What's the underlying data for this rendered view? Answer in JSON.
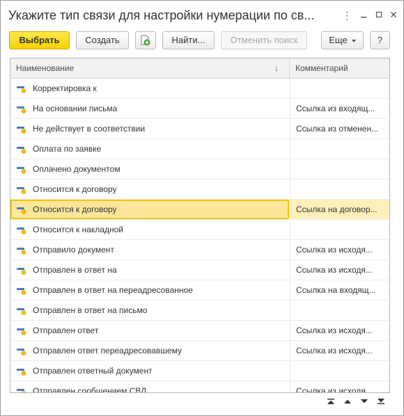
{
  "window": {
    "title": "Укажите тип связи для настройки нумерации по св...",
    "controls": {
      "more": "⋮",
      "minimize": "",
      "maximize": "",
      "close": ""
    }
  },
  "toolbar": {
    "select_label": "Выбрать",
    "create_label": "Создать",
    "find_label": "Найти...",
    "cancel_search_label": "Отменить поиск",
    "more_label": "Еще",
    "help_label": "?"
  },
  "grid": {
    "columns": {
      "name": "Наименование",
      "comment": "Комментарий",
      "sort": "↓"
    },
    "selected_index": 6,
    "rows": [
      {
        "name": "Корректировка к",
        "comment": ""
      },
      {
        "name": "На основании письма",
        "comment": "Ссылка из входящ..."
      },
      {
        "name": "Не действует в соответствии",
        "comment": "Ссылка из отменен..."
      },
      {
        "name": "Оплата по заявке",
        "comment": ""
      },
      {
        "name": "Оплачено документом",
        "comment": ""
      },
      {
        "name": "Относится к договору",
        "comment": ""
      },
      {
        "name": "Относится к договору",
        "comment": "Ссылка на договор..."
      },
      {
        "name": "Относится к накладной",
        "comment": ""
      },
      {
        "name": "Отправило документ",
        "comment": "Ссылка из исходя..."
      },
      {
        "name": "Отправлен в ответ на",
        "comment": "Ссылка из исходя..."
      },
      {
        "name": "Отправлен в ответ на переадресованное",
        "comment": "Ссылка на входящ..."
      },
      {
        "name": "Отправлен в ответ на письмо",
        "comment": ""
      },
      {
        "name": "Отправлен ответ",
        "comment": "Ссылка из исходя..."
      },
      {
        "name": "Отправлен ответ переадресовавшему",
        "comment": "Ссылка из исходя..."
      },
      {
        "name": "Отправлен ответный документ",
        "comment": ""
      },
      {
        "name": "Отправлен сообщением СВД",
        "comment": "Ссылка из исходя..."
      }
    ]
  },
  "colors": {
    "primary_button": "#f5d100",
    "selected_row": "#fdf0b9",
    "selected_border": "#f0c800",
    "item_icon_blue": "#4a7bc0",
    "item_icon_yellow": "#f2c200",
    "add_icon_green": "#3aa33a"
  },
  "icons": {
    "row": "reference-item-icon",
    "add_copy": "add-document-icon",
    "nav": [
      "first-page-icon",
      "page-up-icon",
      "page-down-icon",
      "last-page-icon"
    ]
  }
}
